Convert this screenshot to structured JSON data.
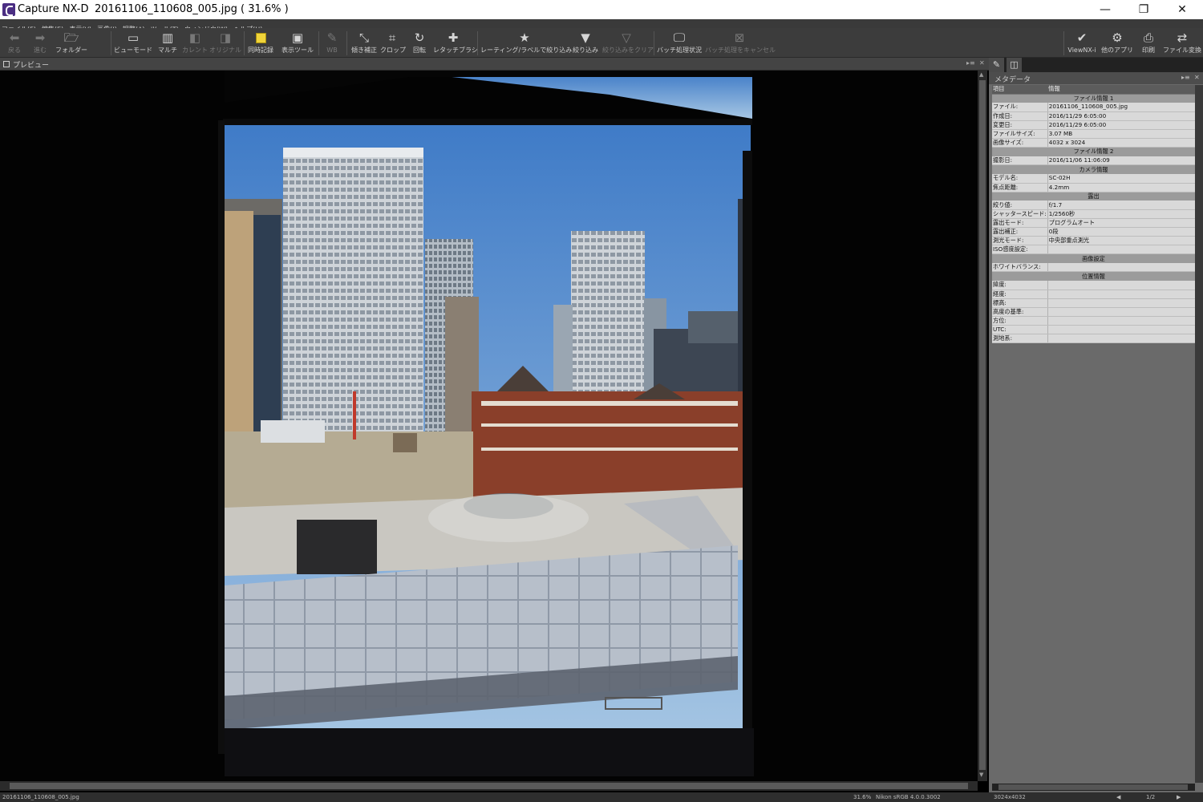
{
  "window": {
    "app_name": "Capture NX-D",
    "document_title": "20161106_110608_005.jpg ( 31.6% )",
    "minimize": "—",
    "restore": "❐",
    "close": "✕"
  },
  "menu": [
    "ファイル(F)",
    "編集(E)",
    "表示(V)",
    "画像(I)",
    "調整(A)",
    "ツール(T)",
    "ウィンドウ(W)",
    "ヘルプ(H)"
  ],
  "toolbar": {
    "back": "戻る",
    "forward": "進む",
    "folder": "フォルダー",
    "view_mode": "ビューモード",
    "multi": "マルチ",
    "current": "カレント",
    "original": "オリジナル",
    "sync_record": "同時記録",
    "display_tool": "表示ツール",
    "wb": "WB",
    "tilt": "傾き補正",
    "crop": "クロップ",
    "rotate": "回転",
    "retouch": "レタッチブラシ",
    "rating_filter": "レーティング/ラベルで絞り込み",
    "filter": "絞り込み",
    "clear_filter": "絞り込みをクリア",
    "batch_status": "バッチ処理状況",
    "batch_cancel": "バッチ処理をキャンセル",
    "viewnx": "ViewNX-i",
    "other_apps": "他のアプリ",
    "print": "印刷",
    "file_convert": "ファイル変換"
  },
  "preview": {
    "title": "プレビュー"
  },
  "metadata": {
    "title": "メタデータ",
    "col_item": "項目",
    "col_info": "情報",
    "rows": [
      {
        "type": "section",
        "label": "ファイル情報 1"
      },
      {
        "type": "row",
        "key": "ファイル:",
        "value": "20161106_110608_005.jpg"
      },
      {
        "type": "row",
        "key": "作成日:",
        "value": "2016/11/29 6:05:00"
      },
      {
        "type": "row",
        "key": "変更日:",
        "value": "2016/11/29 6:05:00"
      },
      {
        "type": "row",
        "key": "ファイルサイズ:",
        "value": "3.07 MB"
      },
      {
        "type": "row",
        "key": "画像サイズ:",
        "value": "4032 x 3024"
      },
      {
        "type": "section",
        "label": "ファイル情報 2"
      },
      {
        "type": "row",
        "key": "撮影日:",
        "value": "2016/11/06 11:06:09"
      },
      {
        "type": "section",
        "label": "カメラ情報"
      },
      {
        "type": "row",
        "key": "モデル名:",
        "value": "SC-02H"
      },
      {
        "type": "row",
        "key": "焦点距離:",
        "value": "4.2mm"
      },
      {
        "type": "section",
        "label": "露出"
      },
      {
        "type": "row",
        "key": "絞り値:",
        "value": "f/1.7"
      },
      {
        "type": "row",
        "key": "シャッタースピード:",
        "value": "1/2560秒"
      },
      {
        "type": "row",
        "key": "露出モード:",
        "value": "プログラムオート"
      },
      {
        "type": "row",
        "key": "露出補正:",
        "value": "0段"
      },
      {
        "type": "row",
        "key": "測光モード:",
        "value": "中央部重点測光"
      },
      {
        "type": "row",
        "key": "ISO感度設定:",
        "value": ""
      },
      {
        "type": "section",
        "label": "画像設定"
      },
      {
        "type": "row",
        "key": "ホワイトバランス:",
        "value": ""
      },
      {
        "type": "section",
        "label": "位置情報"
      },
      {
        "type": "row",
        "key": "緯度:",
        "value": ""
      },
      {
        "type": "row",
        "key": "経度:",
        "value": ""
      },
      {
        "type": "row",
        "key": "標高:",
        "value": ""
      },
      {
        "type": "row",
        "key": "高度の基準:",
        "value": ""
      },
      {
        "type": "row",
        "key": "方位:",
        "value": ""
      },
      {
        "type": "row",
        "key": "UTC:",
        "value": ""
      },
      {
        "type": "row",
        "key": "測地系:",
        "value": ""
      }
    ]
  },
  "status": {
    "filename": "20161106_110608_005.jpg",
    "zoom": "31.6%",
    "profile": "Nikon sRGB 4.0.0.3002",
    "dimensions": "3024x4032",
    "page": "1/2"
  }
}
